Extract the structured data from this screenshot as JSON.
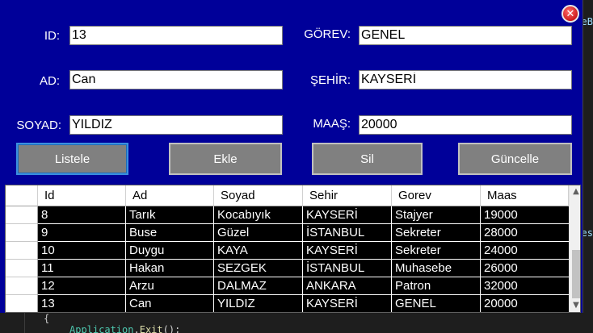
{
  "window": {
    "close_icon": "close-icon"
  },
  "form": {
    "id_label": "ID:",
    "id_value": "13",
    "ad_label": "AD:",
    "ad_value": "Can",
    "soyad_label": "SOYAD:",
    "soyad_value": "YILDIZ",
    "gorev_label": "GÖREV:",
    "gorev_value": "GENEL",
    "sehir_label": "ŞEHİR:",
    "sehir_value": "KAYSERİ",
    "maas_label": "MAAŞ:",
    "maas_value": "20000"
  },
  "buttons": {
    "listele": "Listele",
    "ekle": "Ekle",
    "sil": "Sil",
    "guncelle": "Güncelle"
  },
  "grid": {
    "columns": [
      "Id",
      "Ad",
      "Soyad",
      "Sehir",
      "Gorev",
      "Maas"
    ],
    "rows": [
      [
        "8",
        "Tarık",
        "Kocabıyık",
        "KAYSERİ",
        "Stajyer",
        "19000"
      ],
      [
        "9",
        "Buse",
        "Güzel",
        "İSTANBUL",
        "Sekreter",
        "28000"
      ],
      [
        "10",
        "Duygu",
        "KAYA",
        "KAYSERİ",
        "Sekreter",
        "24000"
      ],
      [
        "11",
        "Hakan",
        "SEZGEK",
        "İSTANBUL",
        "Muhasebe",
        "26000"
      ],
      [
        "12",
        "Arzu",
        "DALMAZ",
        "ANKARA",
        "Patron",
        "32000"
      ],
      [
        "13",
        "Can",
        "YILDIZ",
        "KAYSERİ",
        "GENEL",
        "20000"
      ]
    ]
  },
  "editor": {
    "brace": "{",
    "code_class": "Application",
    "code_dot": ".",
    "code_method": "Exit",
    "code_tail": "();",
    "right_fragment_1": "eB",
    "right_fragment_2": "es"
  },
  "colors": {
    "form_background": "#000099",
    "button_gray": "#808080",
    "grid_cell_bg": "#000000",
    "editor_bg": "#1e1e1e"
  }
}
